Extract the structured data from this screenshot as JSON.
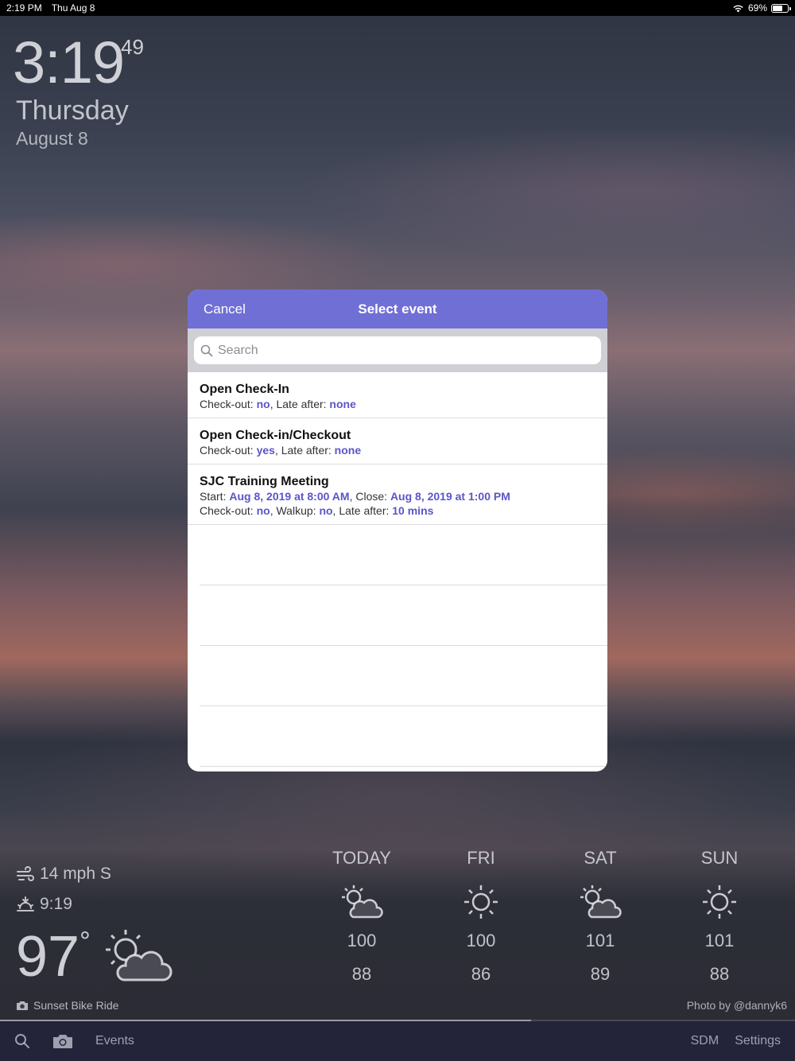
{
  "status_bar": {
    "time": "2:19 PM",
    "date": "Thu Aug 8",
    "battery": "69%",
    "battery_level": 0.69
  },
  "clock": {
    "time": "3:19",
    "seconds": "49",
    "weekday": "Thursday",
    "date": "August 8"
  },
  "modal": {
    "cancel_label": "Cancel",
    "title": "Select event",
    "search_placeholder": "Search",
    "events": [
      {
        "name": "Open Check-In",
        "checkout_label": "Check-out:",
        "checkout": "no",
        "late_label": "Late after:",
        "late": "none"
      },
      {
        "name": "Open Check-in/Checkout",
        "checkout_label": "Check-out:",
        "checkout": "yes",
        "late_label": "Late after:",
        "late": "none"
      },
      {
        "name": "SJC Training Meeting",
        "start_label": "Start:",
        "start": "Aug 8, 2019 at 8:00 AM",
        "close_label": "Close:",
        "close": "Aug 8, 2019 at 1:00 PM",
        "checkout_label": "Check-out:",
        "checkout": "no",
        "walkup_label": "Walkup:",
        "walkup": "no",
        "late_label": "Late after:",
        "late": "10 mins"
      }
    ]
  },
  "weather": {
    "wind": "14 mph S",
    "sunset": "9:19",
    "temperature": "97",
    "degree_symbol": "°",
    "current_icon": "sun-cloud-icon",
    "forecast": [
      {
        "day": "TODAY",
        "icon": "sun-cloud-icon",
        "high": "100",
        "low": "88"
      },
      {
        "day": "FRI",
        "icon": "sun-icon",
        "high": "100",
        "low": "86"
      },
      {
        "day": "SAT",
        "icon": "sun-cloud-icon",
        "high": "101",
        "low": "89"
      },
      {
        "day": "SUN",
        "icon": "sun-icon",
        "high": "101",
        "low": "88"
      }
    ]
  },
  "photo": {
    "caption": "Sunset Bike Ride",
    "credit": "Photo by @dannyk6",
    "progress": 0.668
  },
  "bottom_bar": {
    "events_label": "Events",
    "sdm_label": "SDM",
    "settings_label": "Settings"
  },
  "colors": {
    "accent": "#6f6fd6",
    "value_highlight": "#5b55c9",
    "bottom_bar": "#23243a"
  }
}
